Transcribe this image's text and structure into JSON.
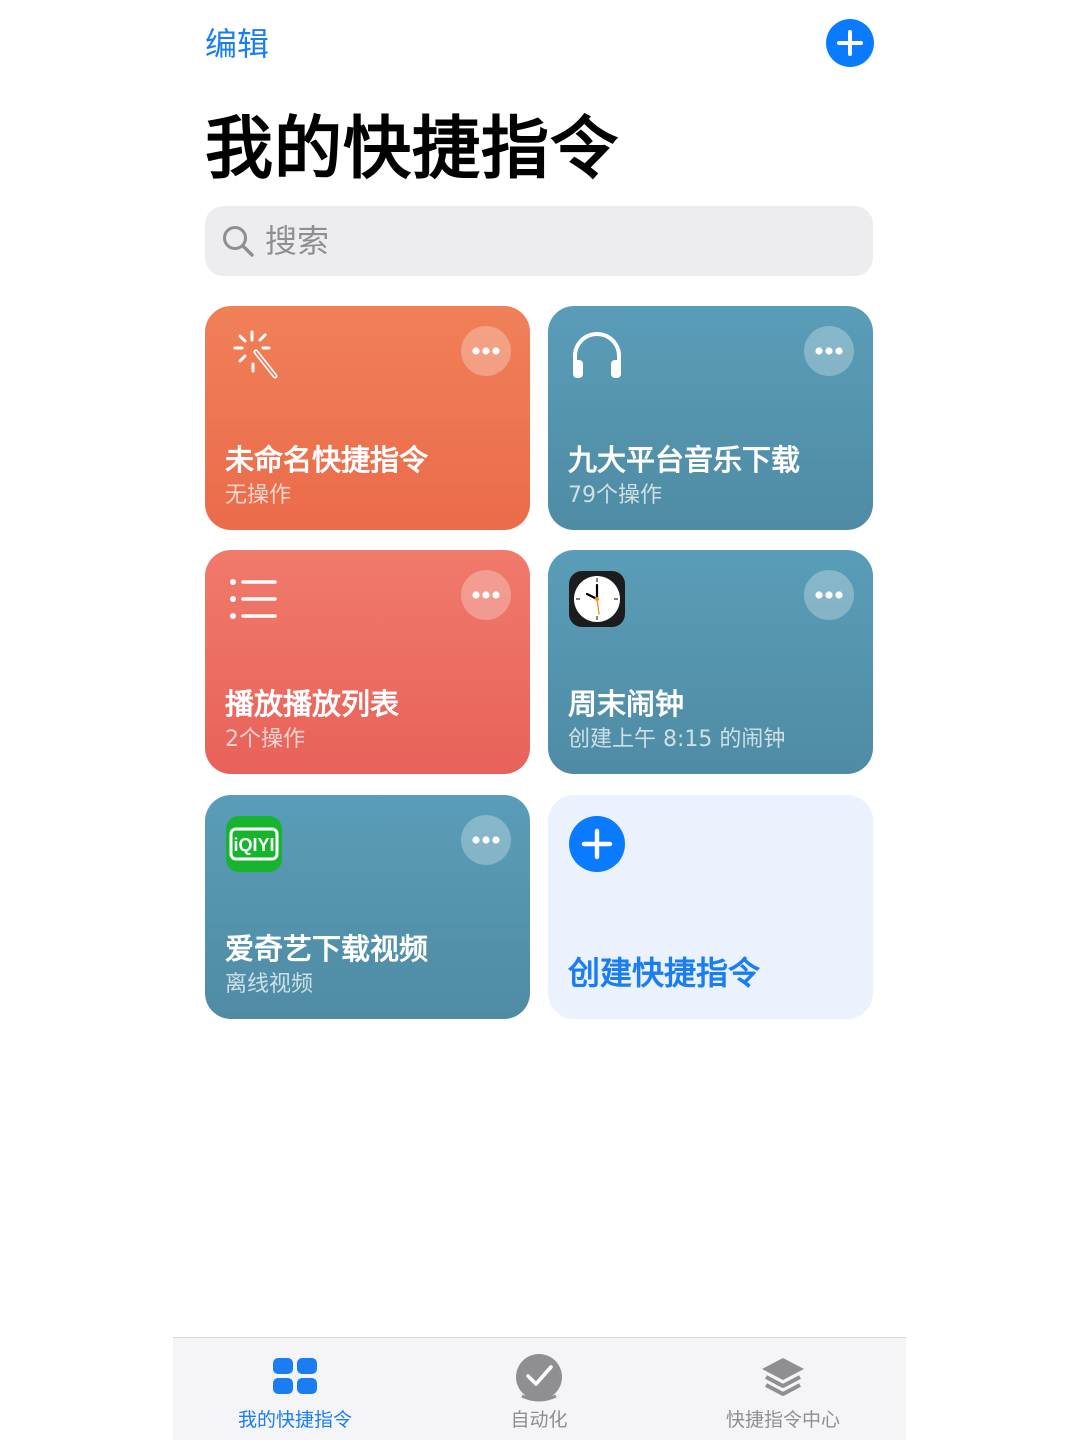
{
  "header": {
    "edit_label": "编辑",
    "add_icon": "plus-circle-icon",
    "title": "我的快捷指令"
  },
  "search": {
    "placeholder": "搜索",
    "icon": "search-icon"
  },
  "shortcuts": [
    {
      "title": "未命名快捷指令",
      "subtitle": "无操作",
      "icon": "magic-wand-icon",
      "color": "#ee7552"
    },
    {
      "title": "九大平台音乐下载",
      "subtitle": "79个操作",
      "icon": "headphones-icon",
      "color": "#5596b0"
    },
    {
      "title": "播放播放列表",
      "subtitle": "2个操作",
      "icon": "list-icon",
      "color": "#ec6e62"
    },
    {
      "title": "周末闹钟",
      "subtitle": "创建上午 8:15 的闹钟",
      "icon": "clock-app-icon",
      "color": "#5596b0"
    },
    {
      "title": "爱奇艺下载视频",
      "subtitle": "离线视频",
      "icon": "iqiyi-app-icon",
      "color": "#5596b0"
    }
  ],
  "create_card": {
    "title": "创建快捷指令",
    "icon": "plus-circle-icon"
  },
  "tabs": [
    {
      "label": "我的快捷指令",
      "icon": "grid-icon",
      "active": true
    },
    {
      "label": "自动化",
      "icon": "checkmark-circle-icon",
      "active": false
    },
    {
      "label": "快捷指令中心",
      "icon": "layers-icon",
      "active": false
    }
  ],
  "colors": {
    "accent": "#1a7ef2",
    "orange": "#ee7552",
    "teal": "#5596b0",
    "red": "#ec6e62",
    "create_bg": "#ebf1fd"
  }
}
